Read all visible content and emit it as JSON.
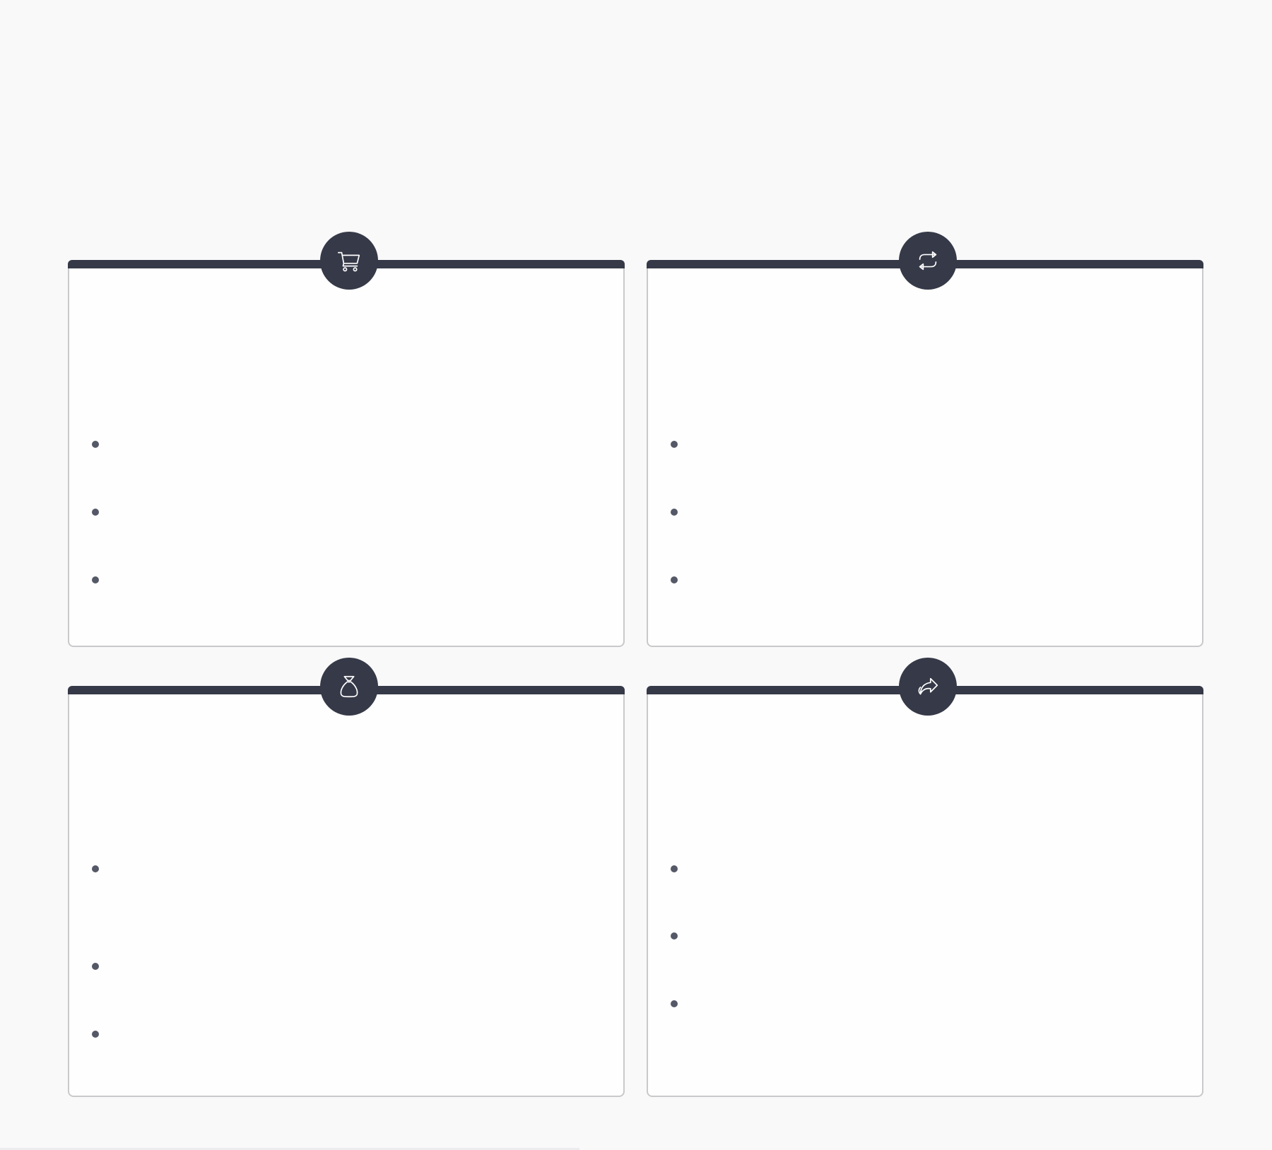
{
  "page": {
    "title": ""
  },
  "colors": {
    "accent": "#363947",
    "border": "#c9c9cb",
    "background": "#f9f9fa",
    "card_background": "#fefefe",
    "bullet": "#555867"
  },
  "cards": [
    {
      "icon": "shopping-cart-icon",
      "title": "",
      "items": [
        "",
        "",
        ""
      ]
    },
    {
      "icon": "repeat-arrows-icon",
      "title": "",
      "items": [
        "",
        "",
        ""
      ]
    },
    {
      "icon": "money-bag-icon",
      "title": "",
      "items": [
        "",
        "",
        ""
      ]
    },
    {
      "icon": "share-arrow-icon",
      "title": "",
      "items": [
        "",
        "",
        ""
      ]
    }
  ]
}
